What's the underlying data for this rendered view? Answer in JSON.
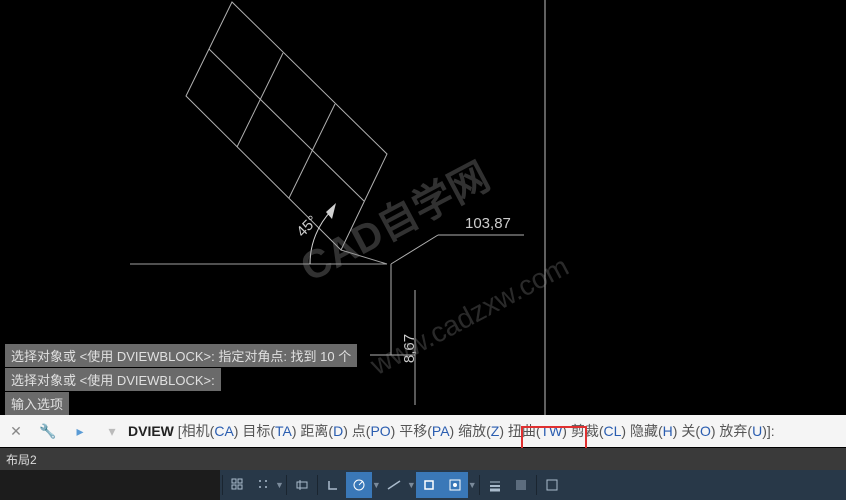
{
  "canvas": {
    "dim_text": "103,87",
    "angle_label": "45°",
    "height_label": "8,67"
  },
  "watermarks": {
    "text1": "CAD自学网",
    "text2": "www.cadzxw.com"
  },
  "history": {
    "line1": "选择对象或 <使用 DVIEWBLOCK>: 指定对角点: 找到 10 个",
    "line2": "选择对象或 <使用 DVIEWBLOCK>:",
    "line3": "输入选项"
  },
  "command": {
    "name": "DVIEW",
    "options": [
      {
        "label": "相机",
        "key": "CA"
      },
      {
        "label": "目标",
        "key": "TA"
      },
      {
        "label": "距离",
        "key": "D"
      },
      {
        "label": "点",
        "key": "PO"
      },
      {
        "label": "平移",
        "key": "PA"
      },
      {
        "label": "缩放",
        "key": "Z"
      },
      {
        "label": "扭曲",
        "key": "TW"
      },
      {
        "label": "剪裁",
        "key": "CL"
      },
      {
        "label": "隐藏",
        "key": "H"
      },
      {
        "label": "关",
        "key": "O"
      },
      {
        "label": "放弃",
        "key": "U"
      }
    ]
  },
  "tabs": {
    "layout": "布局2"
  },
  "status_icons": {
    "grid": "grid-icon",
    "snap": "snap-icon",
    "ortho": "ortho-icon",
    "polar": "polar-icon",
    "osnap": "osnap-icon"
  }
}
